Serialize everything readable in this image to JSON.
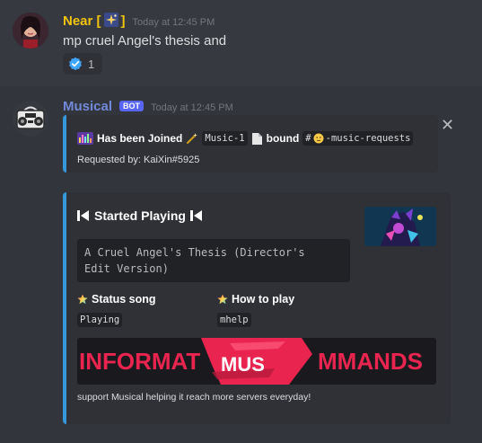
{
  "message1": {
    "author": "Near [",
    "author_suffix": "]",
    "timestamp": "Today at 12:45 PM",
    "content": "mp cruel Angel's thesis and",
    "reaction": {
      "icon": "verified-check-icon",
      "count": "1"
    }
  },
  "message2": {
    "author": "Musical",
    "bot_tag": "BOT",
    "timestamp": "Today at 12:45 PM",
    "embed1": {
      "accent": "#3498db",
      "text_joined": "Has been Joined",
      "channel_voice": "Music-1",
      "text_bound": "bound",
      "channel_text": "-music-requests",
      "requested_by": "Requested by: KaiXin#5925"
    },
    "embed2": {
      "accent": "#3498db",
      "title": "Started Playing",
      "song": "A Cruel Angel's Thesis (Director's Edit Version)",
      "fields": [
        {
          "name": "Status song",
          "value": "Playing"
        },
        {
          "name": "How to play",
          "value": "mhelp"
        }
      ],
      "banner_text_left": "INFORMAT",
      "banner_text_mid": "MUS",
      "banner_text_right": "MMANDS",
      "footer": "support Musical helping it reach more servers everyday!"
    }
  },
  "colors": {
    "background": "#36393f",
    "embed_bg": "#2f3136",
    "near_name": "#f1c40f",
    "musical_name": "#7289da",
    "bot_tag": "#5865f2",
    "banner_accent": "#e8244f"
  }
}
